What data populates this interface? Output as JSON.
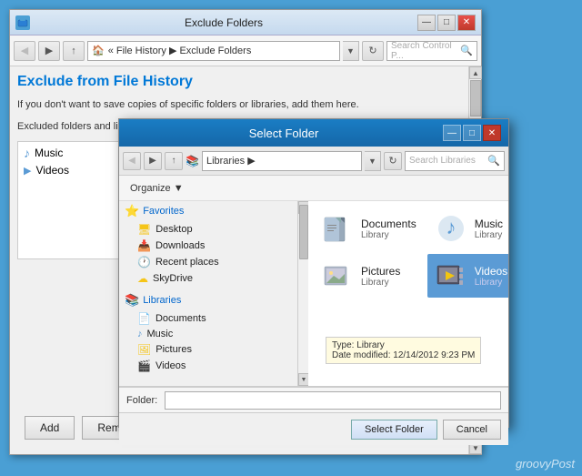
{
  "mainWindow": {
    "title": "Exclude Folders",
    "titleBtns": [
      "—",
      "□",
      "✕"
    ],
    "addressBar": {
      "icon": "🏠",
      "path": "« File History ▶ Exclude Folders",
      "searchPlaceholder": "Search Control P..."
    },
    "pageTitle": "Exclude from File History",
    "pageSubtitle": "If you don't want to save copies of specific folders or libraries, add them here.",
    "excludedLabel": "Excluded folders and libraries:",
    "excludedItems": [
      {
        "name": "Music",
        "type": "music"
      },
      {
        "name": "Videos",
        "type": "video"
      }
    ],
    "addBtn": "Add",
    "removeBtn": "Remove"
  },
  "selectDialog": {
    "title": "Select Folder",
    "titleBtns": [
      "—",
      "□",
      "✕"
    ],
    "addressPath": "Libraries ▶",
    "organizeLabel": "Organize ▼",
    "searchPlaceholder": "Search Libraries",
    "navSections": [
      {
        "label": "Favorites",
        "icon": "⭐",
        "items": [
          {
            "label": "Desktop",
            "icon": "🖥"
          },
          {
            "label": "Downloads",
            "icon": "📥"
          },
          {
            "label": "Recent places",
            "icon": "🕐"
          },
          {
            "label": "SkyDrive",
            "icon": "☁"
          }
        ]
      },
      {
        "label": "Libraries",
        "icon": "📚",
        "items": [
          {
            "label": "Documents",
            "icon": "📄"
          },
          {
            "label": "Music",
            "icon": "♪"
          },
          {
            "label": "Pictures",
            "icon": "🖼"
          },
          {
            "label": "Videos",
            "icon": "🎬"
          }
        ]
      }
    ],
    "libraryItems": [
      {
        "name": "Documents",
        "subtitle": "Library",
        "type": "docs"
      },
      {
        "name": "Music",
        "subtitle": "Library",
        "type": "music"
      },
      {
        "name": "Pictures",
        "subtitle": "Library",
        "type": "pictures"
      },
      {
        "name": "Videos",
        "subtitle": "Library",
        "type": "videos",
        "selected": true
      }
    ],
    "folderLabel": "Folder:",
    "folderValue": "",
    "selectFolderBtn": "Select Folder",
    "cancelBtn": "Cancel"
  },
  "tooltip": {
    "line1": "Type: Library",
    "line2": "Date modified: 12/14/2012 9:23 PM"
  },
  "watermark": "groovyPost"
}
